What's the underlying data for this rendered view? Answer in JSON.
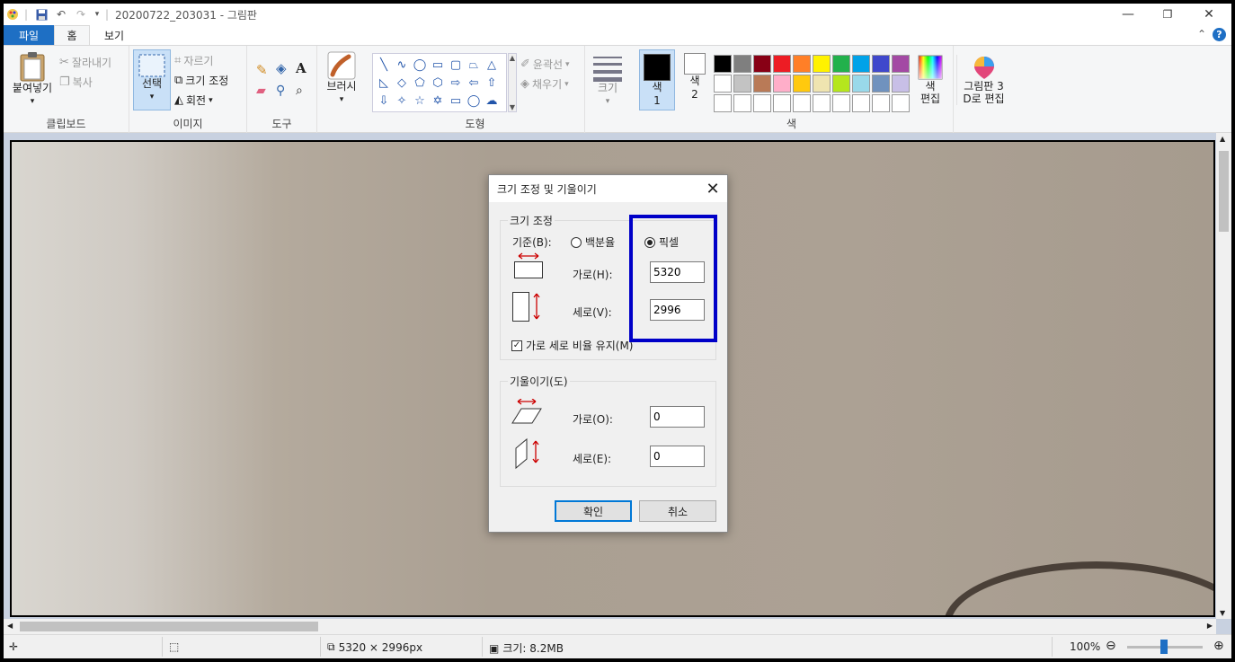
{
  "window": {
    "title": "20200722_203031 - 그림판",
    "minimize_glyph": "—",
    "restore_glyph": "❐",
    "close_glyph": "✕"
  },
  "tabs": [
    {
      "label": "파일"
    },
    {
      "label": "홈"
    },
    {
      "label": "보기"
    }
  ],
  "ribbon": {
    "clipboard": {
      "label": "클립보드",
      "paste": "붙여넣기",
      "cut": "잘라내기",
      "copy": "복사"
    },
    "image": {
      "label": "이미지",
      "select": "선택",
      "crop": "자르기",
      "resize": "크기 조정",
      "rotate": "회전"
    },
    "tools": {
      "label": "도구"
    },
    "brushes": {
      "label": "브러시"
    },
    "shapes": {
      "label": "도형",
      "outline": "윤곽선",
      "fill": "채우기"
    },
    "size": {
      "label": "크기"
    },
    "colors": {
      "label": "색",
      "color1": "색\n1",
      "color2": "색\n2",
      "edit": "색\n편집",
      "paint3d": "그림판 3\nD로 편집",
      "swatches": [
        "#000000",
        "#7f7f7f",
        "#880015",
        "#ed1c24",
        "#ff7f27",
        "#fff200",
        "#22b14c",
        "#00a2e8",
        "#3f48cc",
        "#a349a4",
        "#ffffff",
        "#c3c3c3",
        "#b97a57",
        "#ffaec9",
        "#ffc90e",
        "#efe4b0",
        "#b5e61d",
        "#99d9ea",
        "#7092be",
        "#c8bfe7",
        "#ffffff",
        "#ffffff",
        "#ffffff",
        "#ffffff",
        "#ffffff",
        "#ffffff",
        "#ffffff",
        "#ffffff",
        "#ffffff",
        "#ffffff"
      ]
    }
  },
  "status": {
    "dimensions": "5320 × 2996px",
    "file_size": "크기: 8.2MB",
    "zoom": "100%"
  },
  "dialog": {
    "title": "크기 조정 및 기울이기",
    "resize_legend": "크기 조정",
    "basis_label": "기준(B):",
    "percent_label": "백분율",
    "pixels_label": "픽셀",
    "horizontal_label": "가로(H):",
    "vertical_label": "세로(V):",
    "horizontal_value": "5320",
    "vertical_value": "2996",
    "keep_ratio_label": "가로 세로 비율 유지(M)",
    "skew_legend": "기울이기(도)",
    "skew_horizontal_label": "가로(O):",
    "skew_vertical_label": "세로(E):",
    "skew_horizontal_value": "0",
    "skew_vertical_value": "0",
    "ok_label": "확인",
    "cancel_label": "취소",
    "selected_basis": "pixels",
    "keep_ratio_checked": true
  },
  "highlight_color": "#0000c8"
}
